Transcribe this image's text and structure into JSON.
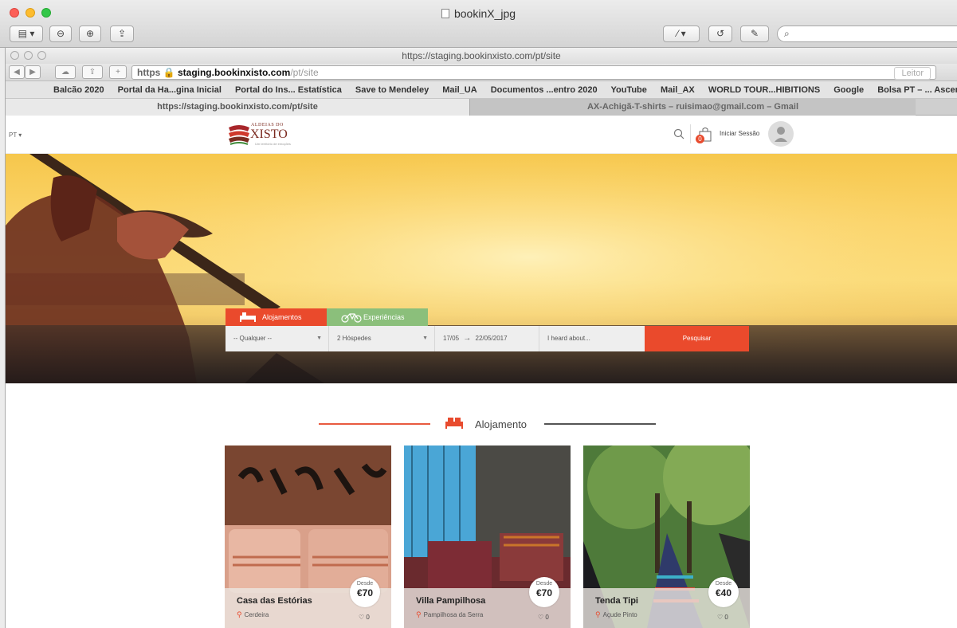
{
  "preview": {
    "title": "bookinX_jpg",
    "search_placeholder": "Q"
  },
  "safari": {
    "window_title": "https://staging.bookinxisto.com/pt/site",
    "address": {
      "scheme": "https",
      "host": "staging.bookinxisto.com",
      "path": "/pt/site"
    },
    "reader_label": "Leitor",
    "bookmarks": [
      "Balcão 2020",
      "Portal da Ha...gina Inicial",
      "Portal do Ins... Estatística",
      "Save to Mendeley",
      "Mail_UA",
      "Documentos ...entro 2020",
      "YouTube",
      "Mail_AX",
      "WORLD TOUR...HIBITIONS",
      "Google",
      "Bolsa PT – ... Ascendente"
    ],
    "tabs": [
      {
        "label": "https://staging.bookinxisto.com/pt/site"
      },
      {
        "label": "AX-Achigã-T-shirts – ruisimao@gmail.com – Gmail"
      }
    ]
  },
  "site": {
    "lang": "PT ▾",
    "logo": {
      "top": "ALDEIAS DO",
      "main": "XISTO",
      "sub": "Um território de emoções"
    },
    "cart_count": "0",
    "login_label": "Iniciar Sessão",
    "search": {
      "tab_accommodation": "Alojamentos",
      "tab_experiences": "Experiências",
      "location": "-- Qualquer --",
      "guests": "2 Hóspedes",
      "dates_from": "17/05",
      "dates_to": "22/05/2017",
      "heard_placeholder": "I heard about...",
      "button": "Pesquisar"
    },
    "section_title": "Alojamento",
    "cards": [
      {
        "name": "Casa das Estórias",
        "location": "Cerdeira",
        "from": "Desde",
        "price": "€70",
        "likes": "0"
      },
      {
        "name": "Villa Pampilhosa",
        "location": "Pampilhosa da Serra",
        "from": "Desde",
        "price": "€70",
        "likes": "0"
      },
      {
        "name": "Tenda Tipi",
        "location": "Açude Pinto",
        "from": "Desde",
        "price": "€40",
        "likes": "0"
      }
    ]
  },
  "colors": {
    "accent": "#ea4a2c",
    "experience_green": "#8bbf7b"
  }
}
